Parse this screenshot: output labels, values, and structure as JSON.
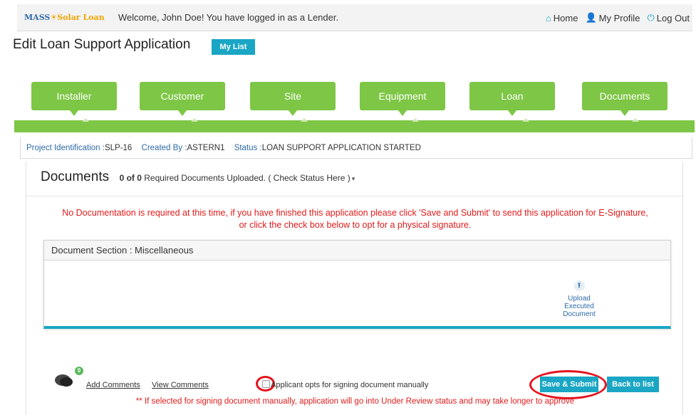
{
  "header": {
    "logo_mass": "MASS",
    "logo_solar": "Solar Loan",
    "welcome": "Welcome, John Doe! You have logged in as a Lender.",
    "nav": [
      {
        "label": "Home",
        "icon": "home-icon"
      },
      {
        "label": "My Profile",
        "icon": "user-icon"
      },
      {
        "label": "Log Out",
        "icon": "power-icon"
      }
    ]
  },
  "page": {
    "title": "Edit Loan Support Application",
    "my_list_label": "My List"
  },
  "steps": [
    "Installer",
    "Customer",
    "Site",
    "Equipment",
    "Loan",
    "Documents"
  ],
  "project": {
    "id_label": "Project Identification :",
    "id_value": "SLP-16",
    "created_label": "Created By :",
    "created_value": "ASTERN1",
    "status_label": "Status :",
    "status_value": "LOAN SUPPORT APPLICATION STARTED"
  },
  "documents": {
    "title": "Documents",
    "count_bold": "0 of 0",
    "count_text": " Required Documents Uploaded. ( Check Status Here )",
    "notice_line1": "No Documentation is required at this time, if you have finished this application please click 'Save and Submit' to send this application for E-Signature,",
    "notice_line2": "or click the check box below to opt for a physical signature.",
    "section_title": "Document Section : Miscellaneous",
    "upload_label": "Upload Executed Document"
  },
  "footer": {
    "comment_count": "0",
    "add_comments": "Add Comments",
    "view_comments": "View Comments",
    "manual_sign_label": "Applicant opts for signing document manually",
    "save_submit": "Save & Submit",
    "back_to_list": "Back to list",
    "warning": "** If selected for signing document manually, application will go into Under Review status and may take longer to approve"
  },
  "colors": {
    "accent": "#1aa6c4",
    "step_green": "#7ec645",
    "alert_red": "#e21b1b",
    "link_blue": "#2d6aa6"
  }
}
